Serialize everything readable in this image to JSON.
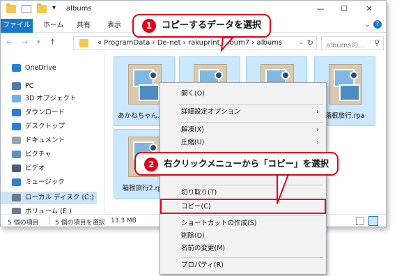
{
  "titlebar": {
    "title": "albums",
    "minimize": "—",
    "maximize": "☐",
    "close": "✕"
  },
  "ribbon": {
    "tabs": [
      "ファイル",
      "ホーム",
      "共有",
      "表示"
    ]
  },
  "address": {
    "path": "« ProgramData › De-net › rakuprint_album7 › albums",
    "search_placeholder": "albumsの..."
  },
  "sidebar": {
    "items": [
      {
        "label": "OneDrive",
        "icon": "cloud-icon",
        "color": "#2a7fd4"
      },
      {
        "label": "PC",
        "icon": "pc-icon",
        "color": "#4a78b0"
      },
      {
        "label": "3D オブジェクト",
        "icon": "cube-icon",
        "color": "#6fb0e6"
      },
      {
        "label": "ダウンロード",
        "icon": "download-icon",
        "color": "#2a7fd4"
      },
      {
        "label": "デスクトップ",
        "icon": "desktop-icon",
        "color": "#2a7fd4"
      },
      {
        "label": "ドキュメント",
        "icon": "document-icon",
        "color": "#9aa3ad"
      },
      {
        "label": "ピクチャ",
        "icon": "pictures-icon",
        "color": "#5a8ec9"
      },
      {
        "label": "ビデオ",
        "icon": "video-icon",
        "color": "#4a5a78"
      },
      {
        "label": "ミュージック",
        "icon": "music-icon",
        "color": "#2a7fd4"
      },
      {
        "label": "ローカル ディスク (C:)",
        "icon": "drive-icon",
        "color": "#6d7a8a"
      },
      {
        "label": "ボリューム (E:)",
        "icon": "drive-icon",
        "color": "#6d7a8a"
      }
    ]
  },
  "files": [
    {
      "label": "あかねちゃん.rpa"
    },
    {
      "label": ""
    },
    {
      "label": ""
    },
    {
      "label": "箱根旅行.rpa"
    },
    {
      "label": "箱根旅行2.rpa"
    }
  ],
  "status": {
    "count": "5 個の項目",
    "selected": "5 個の項目を選択",
    "size": "13.3 MB"
  },
  "context_menu": {
    "items": [
      "開く(O)",
      "詳細設定オプション",
      "解凍(X)",
      "圧縮(U)",
      "切り取り(T)",
      "コピー(C)",
      "ショートカットの作成(S)",
      "削除(D)",
      "名前の変更(M)",
      "プロパティ(R)"
    ]
  },
  "callouts": {
    "step1_num": "1",
    "step1_text": "コピーするデータを選択",
    "step2_num": "2",
    "step2_text": "右クリックメニューから「コピー」を選択"
  },
  "colors": {
    "accent": "#e3001b",
    "selection": "#cce8ff",
    "file_tab": "#1979ca"
  }
}
